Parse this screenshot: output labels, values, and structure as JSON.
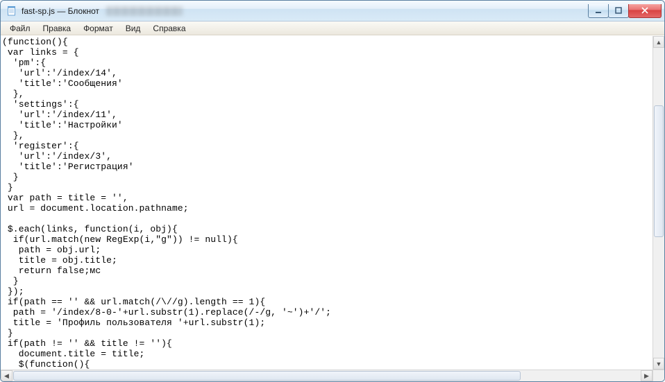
{
  "window": {
    "title": "fast-sp.js — Блокнот"
  },
  "menu": {
    "file": "Файл",
    "edit": "Правка",
    "format": "Формат",
    "view": "Вид",
    "help": "Справка"
  },
  "code": "(function(){\n var links = {\n  'pm':{\n   'url':'/index/14',\n   'title':'Сообщения'\n  },\n  'settings':{\n   'url':'/index/11',\n   'title':'Настройки'\n  },\n  'register':{\n   'url':'/index/3',\n   'title':'Регистрация'\n  }\n }\n var path = title = '',\n url = document.location.pathname;\n\n $.each(links, function(i, obj){\n  if(url.match(new RegExp(i,\"g\")) != null){\n   path = obj.url;\n   title = obj.title;\n   return false;мс\n  }\n });\n if(path == '' && url.match(/\\//g).length == 1){\n  path = '/index/8-0-'+url.substr(1).replace(/-/g, '~')+'/';\n  title = 'Профиль пользователя '+url.substr(1);\n }\n if(path != '' && title != ''){\n   document.title = title;\n   $(function(){\n    $('body').html('<iframe id=\"parent-iframe\" src=\"'+path+'\" style=\"width:100%;height:100%\" frameborder=\"0\"><\\/if\n    $('#parent-iframe').load(function(){\n     $(this).contents().find('a').attr('target', '_top');\n    });"
}
